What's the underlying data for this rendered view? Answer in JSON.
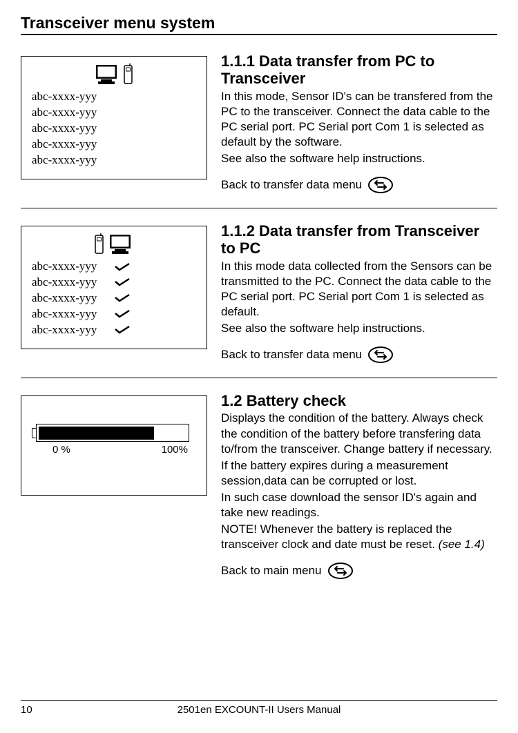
{
  "page_title": "Transceiver menu system",
  "illus_item": "abc-xxxx-yyy",
  "section1": {
    "heading": "1.1.1 Data transfer from PC to Transceiver",
    "p1": "In this mode, Sensor ID's can be transfered from the PC to the transceiver. Connect the data cable to the PC serial port. PC Serial port Com 1 is selected as default by the software.",
    "p2": "See also the software help instructions.",
    "back": "Back to transfer data menu"
  },
  "section2": {
    "heading": "1.1.2 Data transfer from Transceiver to PC",
    "p1": "In this mode data collected from the Sensors can be transmitted to the PC. Connect the data cable to the PC serial port.  PC Serial port Com 1 is selected as default.",
    "p2": "See also the software help instructions.",
    "back": "Back to transfer data menu"
  },
  "section3": {
    "heading": "1.2 Battery check",
    "p1": "Displays the condition of the battery. Always check the condition of the battery before transfering data to/from the transceiver. Change battery if necessary.",
    "p2": "If the battery expires during a measurement session,data can be corrupted or lost.",
    "p3": "In such case download the sensor ID's again and take new readings.",
    "p4a": "NOTE! Whenever the battery is replaced the transceiver clock and date must be reset. ",
    "p4b": "(see 1.4)",
    "back": "Back to main menu"
  },
  "battery": {
    "low": "0 %",
    "high": "100%"
  },
  "footer": {
    "page": "10",
    "title": "2501en EXCOUNT-II Users Manual"
  }
}
